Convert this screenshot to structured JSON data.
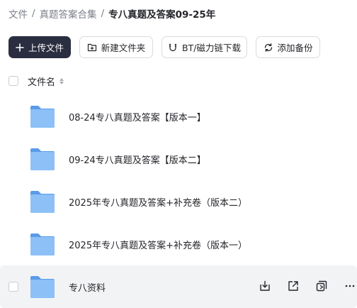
{
  "breadcrumb": {
    "items": [
      "文件",
      "真题答案合集",
      "专八真题及答案09-25年"
    ],
    "separator": "/"
  },
  "toolbar": {
    "upload_label": "上传文件",
    "new_folder_label": "新建文件夹",
    "bt_label": "BT/磁力链下载",
    "backup_label": "添加备份"
  },
  "list": {
    "header_label": "文件名",
    "rows": [
      {
        "name": "08-24专八真题及答案【版本一】"
      },
      {
        "name": "09-24专八真题及答案【版本二】"
      },
      {
        "name": "2025年专八真题及答案+补充卷（版本二）"
      },
      {
        "name": "2025年专八真题及答案+补充卷（版本一）"
      },
      {
        "name": "专八资料"
      }
    ]
  },
  "colors": {
    "primary_button": "#2b2d40",
    "folder_body": "#7fb7f5",
    "folder_tab": "#5a9ae8",
    "hover_row": "#f2f3f5"
  },
  "icons": {
    "row_actions": [
      "download-icon",
      "share-icon",
      "copy-icon",
      "more-icon"
    ]
  }
}
